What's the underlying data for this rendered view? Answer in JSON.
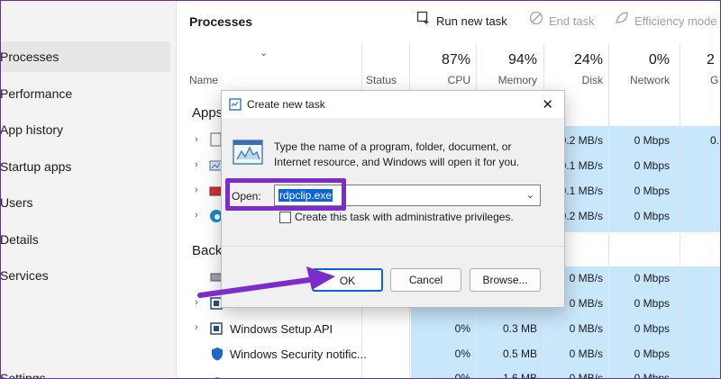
{
  "sidebar": {
    "items": [
      {
        "label": "Processes"
      },
      {
        "label": "Performance"
      },
      {
        "label": "App history"
      },
      {
        "label": "Startup apps"
      },
      {
        "label": "Users"
      },
      {
        "label": "Details"
      },
      {
        "label": "Services"
      },
      {
        "label": "Settings"
      }
    ]
  },
  "header": {
    "title": "Processes",
    "run_new_task": "Run new task",
    "end_task": "End task",
    "efficiency_mode": "Efficiency mode"
  },
  "columns": {
    "name": "Name",
    "status": "Status",
    "cpu_pct": "87%",
    "cpu": "CPU",
    "memory_pct": "94%",
    "memory": "Memory",
    "disk_pct": "24%",
    "disk": "Disk",
    "network_pct": "0%",
    "network": "Network",
    "gpu_pct": "2",
    "gpu": "G"
  },
  "sections": {
    "apps": "Apps",
    "background": "Back"
  },
  "rows": [
    {
      "disk": "0.2 MB/s",
      "network": "0 Mbps",
      "gpu": "0."
    },
    {
      "disk": "0.1 MB/s",
      "network": "0 Mbps"
    },
    {
      "disk": "0.1 MB/s",
      "network": "0 Mbps"
    },
    {
      "disk": "0.2 MB/s",
      "network": "0 Mbps"
    },
    {
      "disk": "0 MB/s",
      "network": "0 Mbps"
    },
    {
      "disk": "0 MB/s",
      "network": "0 Mbps"
    },
    {
      "name": "Windows Setup API",
      "cpu": "0%",
      "memory": "0.3 MB",
      "disk": "0 MB/s",
      "network": "0 Mbps"
    },
    {
      "name": "Windows Security notific...",
      "cpu": "0%",
      "memory": "0.5 MB",
      "disk": "0 MB/s",
      "network": "0 Mbps"
    },
    {
      "cpu": "0%",
      "memory": "1.6 MB",
      "disk": "0 MB/s",
      "network": "0 Mbps"
    }
  ],
  "dialog": {
    "title": "Create new task",
    "message": "Type the name of a program, folder, document, or Internet resource, and Windows will open it for you.",
    "open_label": "Open:",
    "open_value": "rdpclip.exe",
    "admin_checkbox": "Create this task with administrative privileges.",
    "ok": "OK",
    "cancel": "Cancel",
    "browse": "Browse..."
  },
  "colors": {
    "annotation": "#7b2ccb",
    "selection": "#0a64d8",
    "cell_shade": "#c8e7fb"
  }
}
